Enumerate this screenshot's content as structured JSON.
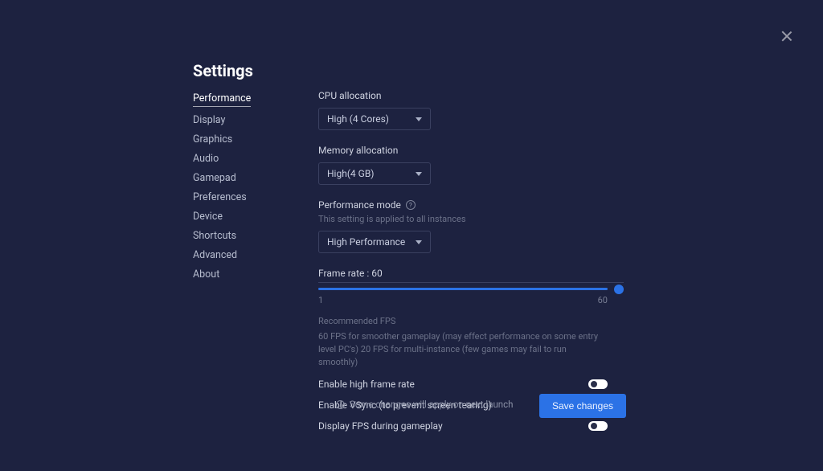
{
  "title": "Settings",
  "sidebar": {
    "items": [
      {
        "label": "Performance",
        "active": true
      },
      {
        "label": "Display"
      },
      {
        "label": "Graphics"
      },
      {
        "label": "Audio"
      },
      {
        "label": "Gamepad"
      },
      {
        "label": "Preferences"
      },
      {
        "label": "Device"
      },
      {
        "label": "Shortcuts"
      },
      {
        "label": "Advanced"
      },
      {
        "label": "About"
      }
    ]
  },
  "cpu": {
    "label": "CPU allocation",
    "value": "High (4 Cores)"
  },
  "memory": {
    "label": "Memory allocation",
    "value": "High(4 GB)"
  },
  "perfmode": {
    "label": "Performance mode",
    "note": "This setting is applied to all instances",
    "value": "High Performance"
  },
  "framerate": {
    "label": "Frame rate : 60",
    "min": "1",
    "max": "60"
  },
  "recommended": {
    "title": "Recommended FPS",
    "body": "60 FPS for smoother gameplay (may effect performance on some entry level PC's) 20 FPS for multi-instance (few games may fail to run smoothly)"
  },
  "toggles": [
    {
      "label": "Enable high frame rate",
      "on": false
    },
    {
      "label": "Enable VSync (to prevent screen tearing)",
      "on": false
    },
    {
      "label": "Display FPS during gameplay",
      "on": false
    }
  ],
  "footer": {
    "note": "Some changes will apply on next launch",
    "save": "Save changes"
  }
}
